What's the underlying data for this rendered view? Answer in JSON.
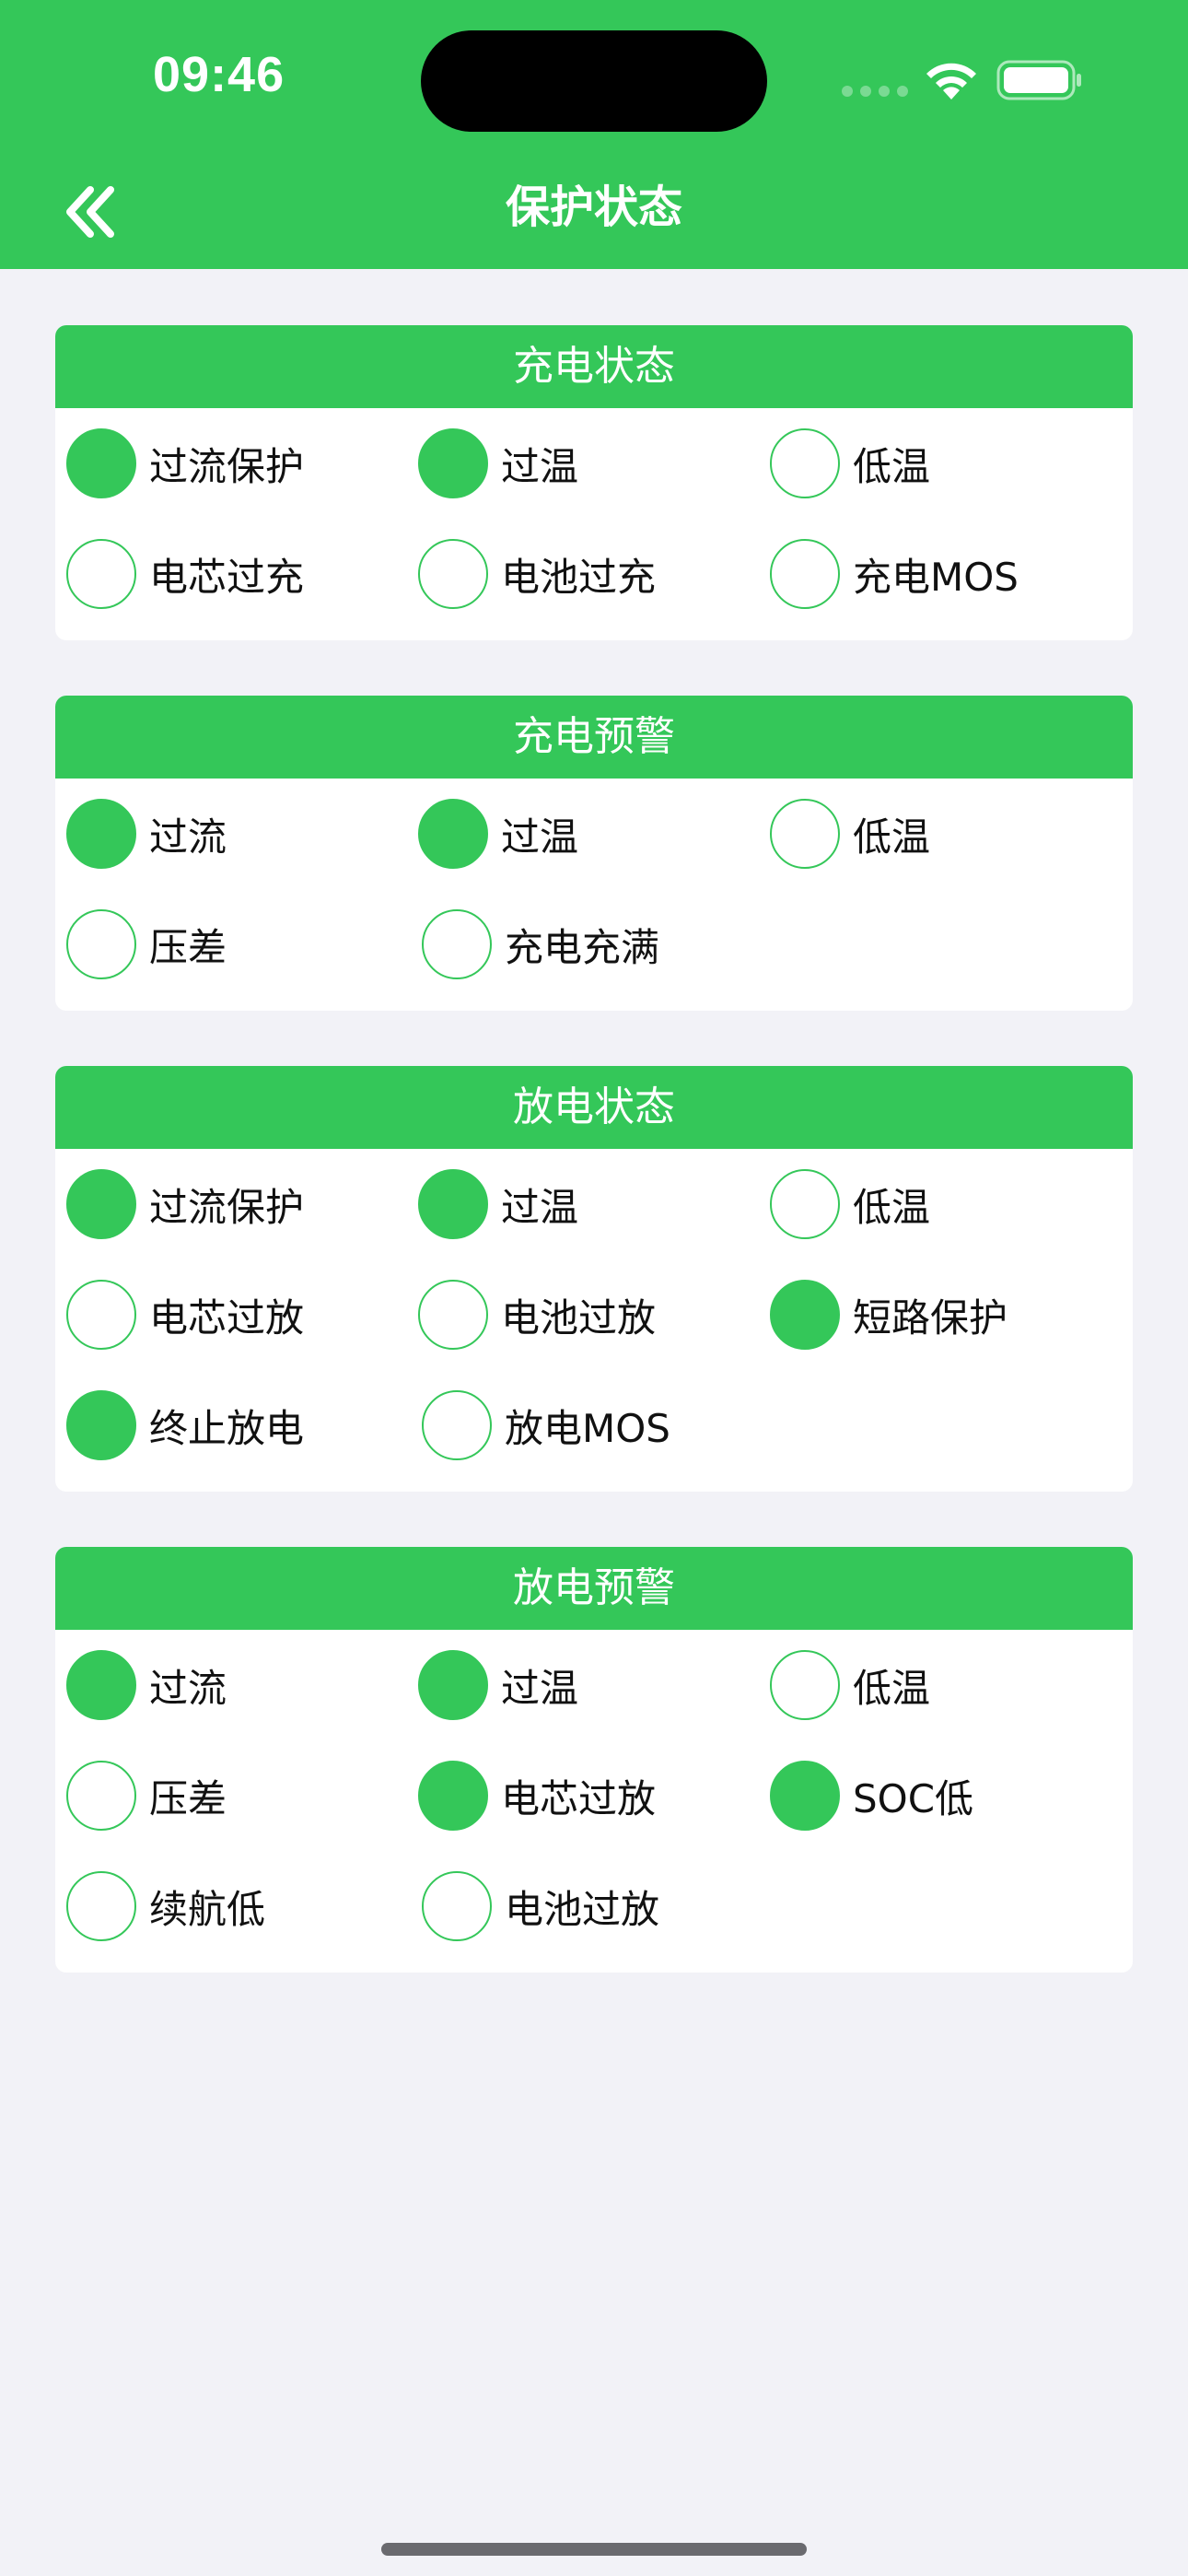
{
  "status_bar": {
    "time": "09:46"
  },
  "nav": {
    "title": "保护状态",
    "back_icon": "double-chevron-left-icon"
  },
  "colors": {
    "accent": "#34c759",
    "background": "#f2f2f7",
    "card": "#ffffff"
  },
  "sections": [
    {
      "title": "充电状态",
      "rows": [
        [
          {
            "label": "过流保护",
            "on": true
          },
          {
            "label": "过温",
            "on": true
          },
          {
            "label": "低温",
            "on": false
          }
        ],
        [
          {
            "label": "电芯过充",
            "on": false
          },
          {
            "label": "电池过充",
            "on": false
          },
          {
            "label": "充电MOS",
            "on": false
          }
        ]
      ]
    },
    {
      "title": "充电预警",
      "rows": [
        [
          {
            "label": "过流",
            "on": true
          },
          {
            "label": "过温",
            "on": true
          },
          {
            "label": "低温",
            "on": false
          }
        ],
        [
          {
            "label": "压差",
            "on": false
          },
          {
            "label": "充电充满",
            "on": false
          }
        ]
      ]
    },
    {
      "title": "放电状态",
      "rows": [
        [
          {
            "label": "过流保护",
            "on": true
          },
          {
            "label": "过温",
            "on": true
          },
          {
            "label": "低温",
            "on": false
          }
        ],
        [
          {
            "label": "电芯过放",
            "on": false
          },
          {
            "label": "电池过放",
            "on": false
          },
          {
            "label": "短路保护",
            "on": true
          }
        ],
        [
          {
            "label": "终止放电",
            "on": true
          },
          {
            "label": "放电MOS",
            "on": false
          }
        ]
      ]
    },
    {
      "title": "放电预警",
      "rows": [
        [
          {
            "label": "过流",
            "on": true
          },
          {
            "label": "过温",
            "on": true
          },
          {
            "label": "低温",
            "on": false
          }
        ],
        [
          {
            "label": "压差",
            "on": false
          },
          {
            "label": "电芯过放",
            "on": true
          },
          {
            "label": "SOC低",
            "on": true
          }
        ],
        [
          {
            "label": "续航低",
            "on": false
          },
          {
            "label": "电池过放",
            "on": false
          }
        ]
      ]
    }
  ]
}
